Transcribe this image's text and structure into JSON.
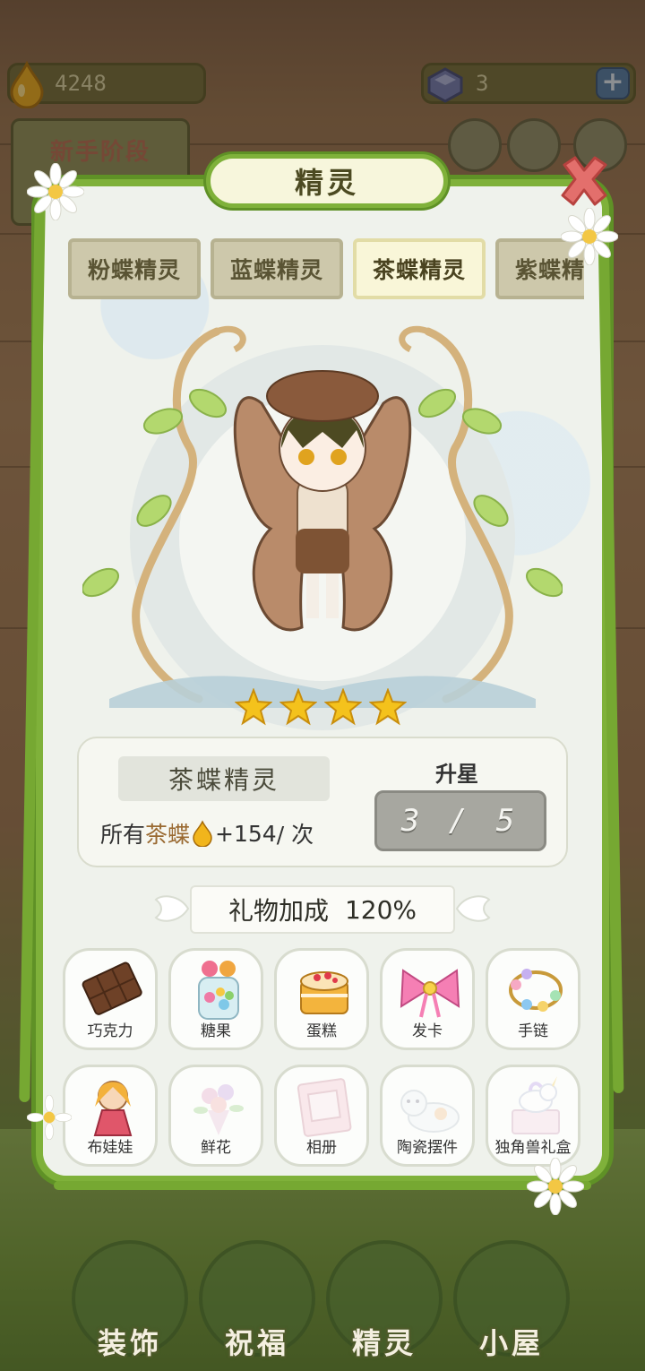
{
  "hud": {
    "coins": "4248",
    "gems": "3",
    "stage_label": "新手阶段"
  },
  "panel": {
    "title": "精灵",
    "tabs": [
      {
        "label": "粉蝶精灵",
        "active": false
      },
      {
        "label": "蓝蝶精灵",
        "active": false
      },
      {
        "label": "茶蝶精灵",
        "active": true
      },
      {
        "label": "紫蝶精灵",
        "active": false
      }
    ],
    "stars": 4,
    "sprite_name": "茶蝶精灵",
    "bonus": {
      "prefix": "所有",
      "highlight": "茶蝶",
      "value": "+154",
      "suffix": " / 次"
    },
    "upgrade": {
      "label": "升星",
      "progress_text": "3 / 5",
      "current": 3,
      "max": 5
    },
    "gift_bonus": {
      "label": "礼物加成",
      "value": "120%"
    },
    "gifts": [
      {
        "label": "巧克力",
        "icon": "chocolate-icon",
        "unlocked": true
      },
      {
        "label": "糖果",
        "icon": "candy-jar-icon",
        "unlocked": true
      },
      {
        "label": "蛋糕",
        "icon": "cake-icon",
        "unlocked": true
      },
      {
        "label": "发卡",
        "icon": "bow-hairclip-icon",
        "unlocked": true
      },
      {
        "label": "手链",
        "icon": "bracelet-icon",
        "unlocked": true
      },
      {
        "label": "布娃娃",
        "icon": "doll-icon",
        "unlocked": true
      },
      {
        "label": "鲜花",
        "icon": "flower-bouquet-icon",
        "unlocked": false
      },
      {
        "label": "相册",
        "icon": "photo-album-icon",
        "unlocked": false
      },
      {
        "label": "陶瓷摆件",
        "icon": "ceramic-cat-icon",
        "unlocked": false
      },
      {
        "label": "独角兽礼盒",
        "icon": "unicorn-box-icon",
        "unlocked": false
      }
    ]
  },
  "bottom_nav": [
    {
      "label": "装饰",
      "icon": "plant-pot-icon"
    },
    {
      "label": "祝福",
      "icon": "fairy-blessing-icon"
    },
    {
      "label": "精灵",
      "icon": "fairy-portrait-icon"
    },
    {
      "label": "小屋",
      "icon": "house-icon"
    }
  ],
  "colors": {
    "vine_green": "#7fb13a",
    "tab_active": "#f9f6d8",
    "tab_inactive": "#cdc8ab",
    "star_gold": "#f4c21c",
    "drop_gold": "#f1b51c"
  }
}
